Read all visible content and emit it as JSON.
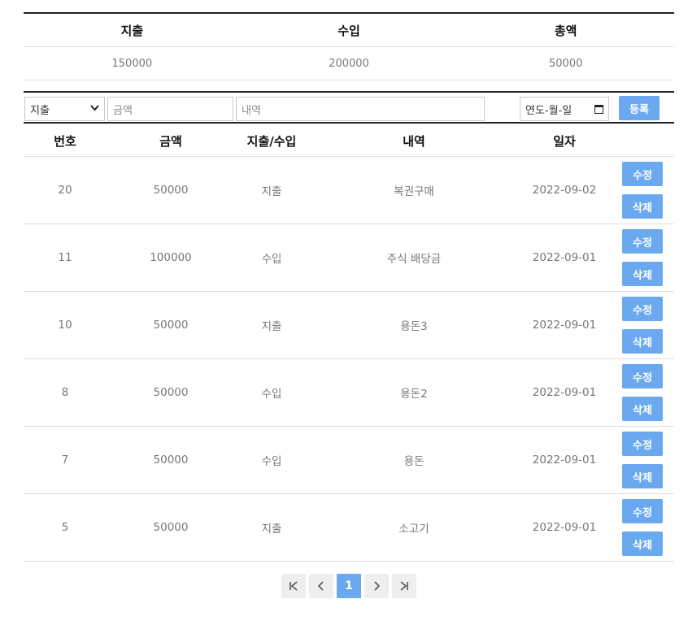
{
  "summary": {
    "headers": [
      "지출",
      "수입",
      "총액"
    ],
    "values": [
      "150000",
      "200000",
      "50000"
    ]
  },
  "form": {
    "type_selected": "지출",
    "amount_placeholder": "금액",
    "memo_placeholder": "내역",
    "date_placeholder": "연도-월-일",
    "register_label": "등록"
  },
  "list": {
    "headers": [
      "번호",
      "금액",
      "지출/수입",
      "내역",
      "일자"
    ],
    "rows": [
      {
        "no": "20",
        "amount": "50000",
        "type": "지출",
        "memo": "복권구매",
        "date": "2022-09-02"
      },
      {
        "no": "11",
        "amount": "100000",
        "type": "수입",
        "memo": "주식 배당금",
        "date": "2022-09-01"
      },
      {
        "no": "10",
        "amount": "50000",
        "type": "지출",
        "memo": "용돈3",
        "date": "2022-09-01"
      },
      {
        "no": "8",
        "amount": "50000",
        "type": "수입",
        "memo": "용돈2",
        "date": "2022-09-01"
      },
      {
        "no": "7",
        "amount": "50000",
        "type": "수입",
        "memo": "용돈",
        "date": "2022-09-01"
      },
      {
        "no": "5",
        "amount": "50000",
        "type": "지출",
        "memo": "소고기",
        "date": "2022-09-01"
      }
    ],
    "edit_label": "수정",
    "delete_label": "삭제"
  },
  "pagination": {
    "current_page": "1"
  },
  "colors": {
    "accent": "#6aa9ef"
  }
}
